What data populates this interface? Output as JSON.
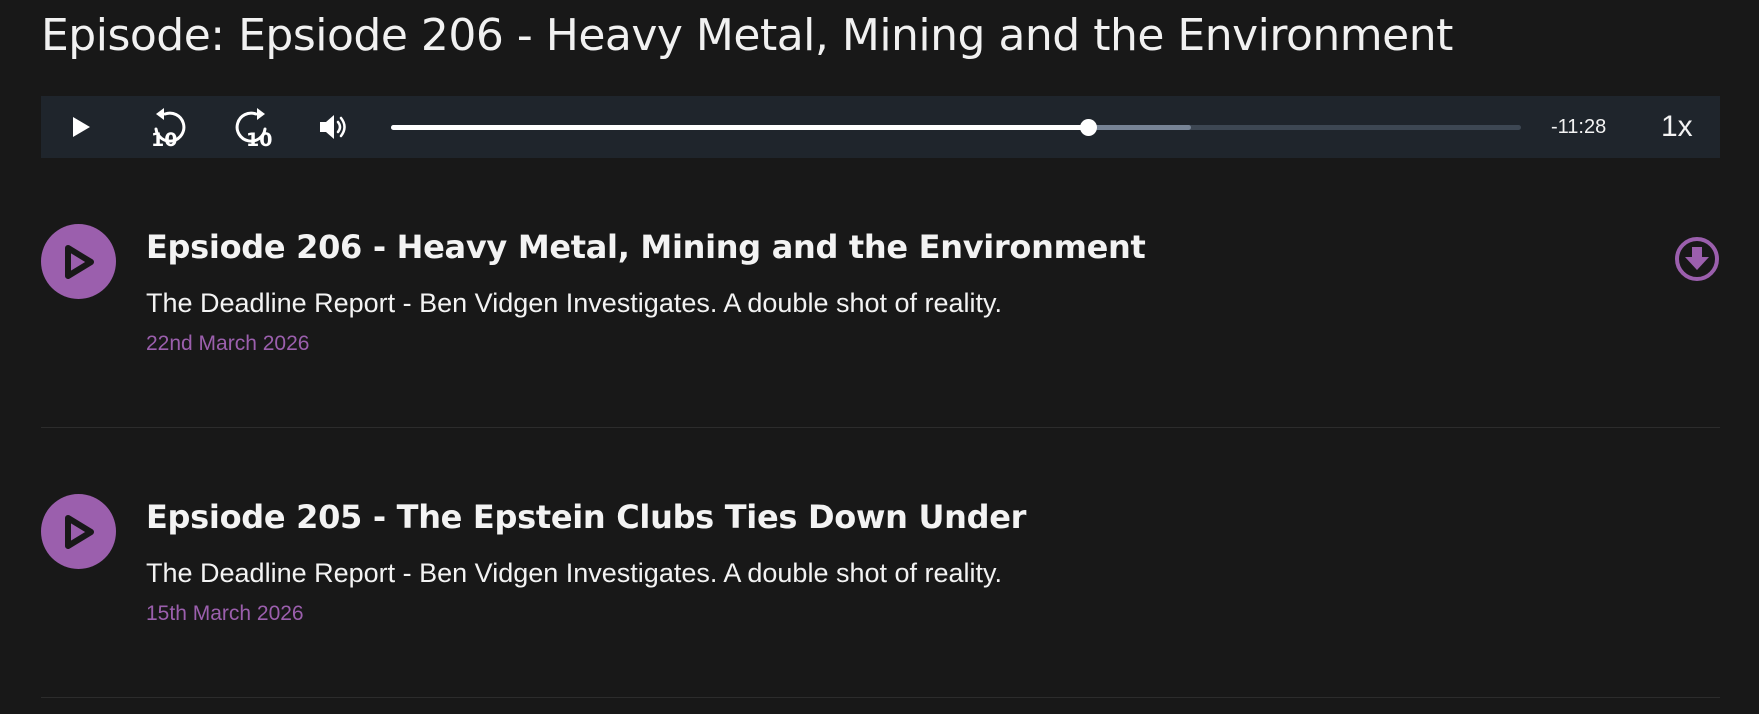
{
  "page": {
    "title": "Episode: Epsiode 206 - Heavy Metal, Mining and the Environment"
  },
  "player": {
    "play_icon": "play-icon",
    "rewind_icon": "rewind-10-icon",
    "rewind_label": "10",
    "forward_icon": "forward-10-icon",
    "forward_label": "10",
    "volume_icon": "volume-icon",
    "progress_played_fraction": 0.617,
    "progress_buffered_fraction": 0.708,
    "time_remaining": "-11:28",
    "speed": "1x"
  },
  "episodes": [
    {
      "title": "Epsiode 206 - Heavy Metal, Mining and the Environment",
      "description": "The Deadline Report - Ben Vidgen Investigates. A double shot of reality.",
      "date": "22nd March 2026",
      "has_download": true
    },
    {
      "title": "Epsiode 205 - The Epstein Clubs Ties Down Under",
      "description": "The Deadline Report - Ben Vidgen Investigates. A double shot of reality.",
      "date": "15th March 2026",
      "has_download": false
    }
  ],
  "colors": {
    "background": "#181818",
    "player_bar": "#1f252c",
    "accent": "#9b5fad",
    "text": "#f3f3f3"
  }
}
